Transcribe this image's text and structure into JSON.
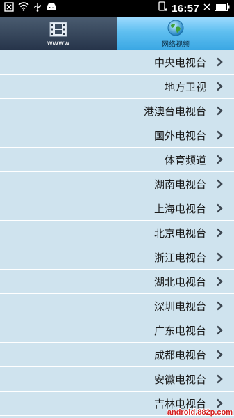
{
  "status_bar": {
    "time": "16:57",
    "icons": [
      "close-box-icon",
      "wifi-icon",
      "usb-icon",
      "android-icon",
      "phone-sync-icon",
      "signal-x-icon",
      "battery-full-icon"
    ]
  },
  "tabs": [
    {
      "label": "wwww",
      "icon": "film-reel-icon",
      "selected": false
    },
    {
      "label": "网络视频",
      "icon": "globe-icon",
      "selected": true
    }
  ],
  "channels": [
    "中央电视台",
    "地方卫视",
    "港澳台电视台",
    "国外电视台",
    "体育频道",
    "湖南电视台",
    "上海电视台",
    "北京电视台",
    "浙江电视台",
    "湖北电视台",
    "深圳电视台",
    "广东电视台",
    "成都电视台",
    "安徽电视台",
    "吉林电视台"
  ],
  "watermark": "android.882p.com",
  "colors": {
    "list_bg": "#cfe3ee",
    "selected_tab": "#3aa7e3",
    "status_bar": "#000000"
  }
}
